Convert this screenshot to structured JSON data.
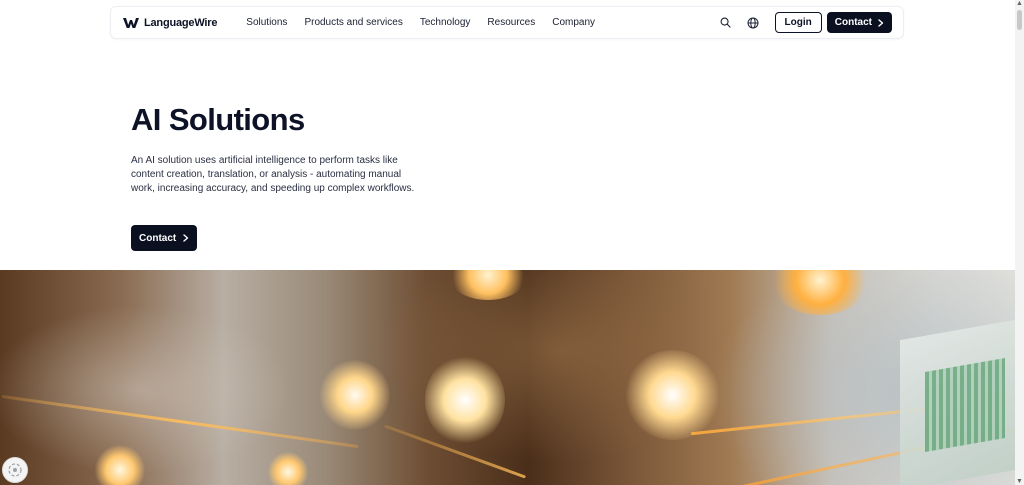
{
  "brand": {
    "name": "LanguageWire"
  },
  "nav": {
    "items": [
      {
        "label": "Solutions"
      },
      {
        "label": "Products and services"
      },
      {
        "label": "Technology"
      },
      {
        "label": "Resources"
      },
      {
        "label": "Company"
      }
    ],
    "login_label": "Login",
    "contact_label": "Contact"
  },
  "hero": {
    "title": "AI Solutions",
    "description": "An AI solution uses artificial intelligence to perform tasks like content creation, translation, or analysis - automating manual work, increasing accuracy, and speeding up complex workflows.",
    "cta_label": "Contact"
  },
  "icons": {
    "search": "search-icon",
    "language": "globe-icon",
    "chevron": "chevron-right-icon",
    "widget": "consent-widget-icon"
  },
  "colors": {
    "primary_dark": "#0b1021",
    "text": "#0d1226",
    "background": "#ffffff"
  }
}
